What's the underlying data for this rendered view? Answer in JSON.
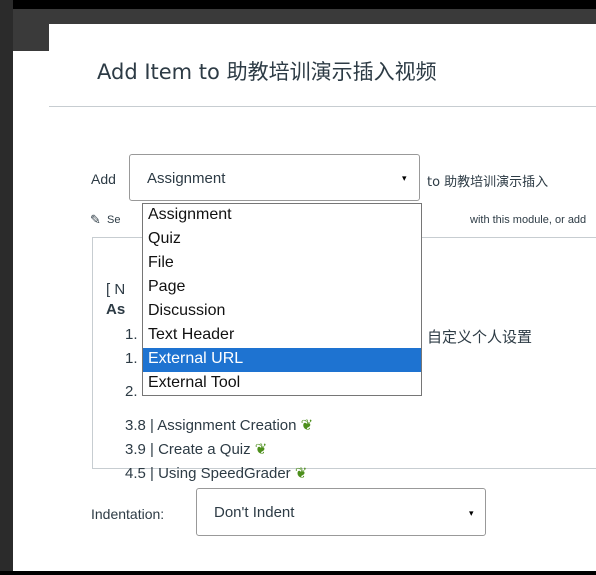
{
  "dialog": {
    "title": "Add Item to 助教培训演示插入视频",
    "add_label": "Add",
    "to_label": "to 助教培训演示插入",
    "type_select": {
      "selected": "Assignment"
    },
    "helper_text": {
      "left": "Se",
      "right": "with this module, or add"
    },
    "list": {
      "lines": [
        {
          "text": "[ N"
        },
        {
          "text": "As"
        },
        {
          "text": "1."
        },
        {
          "text": "1."
        },
        {
          "text": "2."
        },
        {
          "text": "3.8 | Assignment Creation"
        },
        {
          "text": "3.9 | Create a Quiz"
        },
        {
          "text": "4.5 | Using SpeedGrader"
        }
      ],
      "partial_item": "自定义个人设置"
    },
    "indentation_label": "Indentation:",
    "indentation_select": {
      "selected": "Don't Indent"
    }
  },
  "dropdown": {
    "options": [
      "Assignment",
      "Quiz",
      "File",
      "Page",
      "Discussion",
      "Text Header",
      "External URL",
      "External Tool"
    ],
    "highlighted": "External URL"
  },
  "icons": {
    "caret": "▾",
    "leaf": "❦",
    "help": "✎"
  },
  "colors": {
    "highlight": "#1e73d1",
    "leaf": "#4d8f1c"
  }
}
